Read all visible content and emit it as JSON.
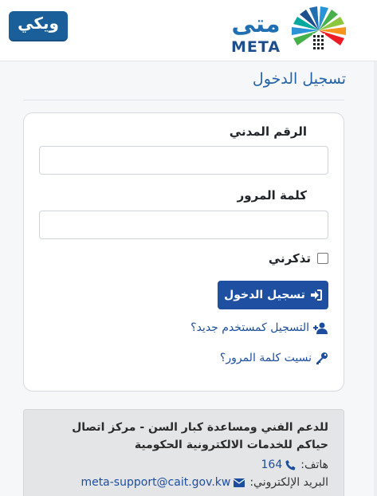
{
  "header": {
    "wiki_logo_text": "ويكي",
    "meta_logo_ar": "متى",
    "meta_logo_en": "META"
  },
  "page": {
    "title": "تسجيل الدخول"
  },
  "form": {
    "civil_id_label": "الرقم المدني",
    "civil_id_value": "",
    "password_label": "كلمة المرور",
    "password_value": "",
    "remember_label": "تذكرني",
    "remember_checked": false,
    "login_button_label": "تسجيل الدخول",
    "register_link": "التسجيل كمستخدم جديد؟",
    "forgot_link": "نسيت كلمة المرور؟"
  },
  "support": {
    "title": "للدعم الفني ومساعدة كبار السن - مركز اتصال حياكم للخدمات الالكترونية الحكومية",
    "phone_label": "هاتف:",
    "phone_value": "164",
    "email_label": "البريد الإلكتروني:",
    "email_value": "meta-support@cait.gov.kw"
  },
  "colors": {
    "primary": "#1f4fa1",
    "link": "#1d4e9e",
    "title": "#2563a8"
  }
}
